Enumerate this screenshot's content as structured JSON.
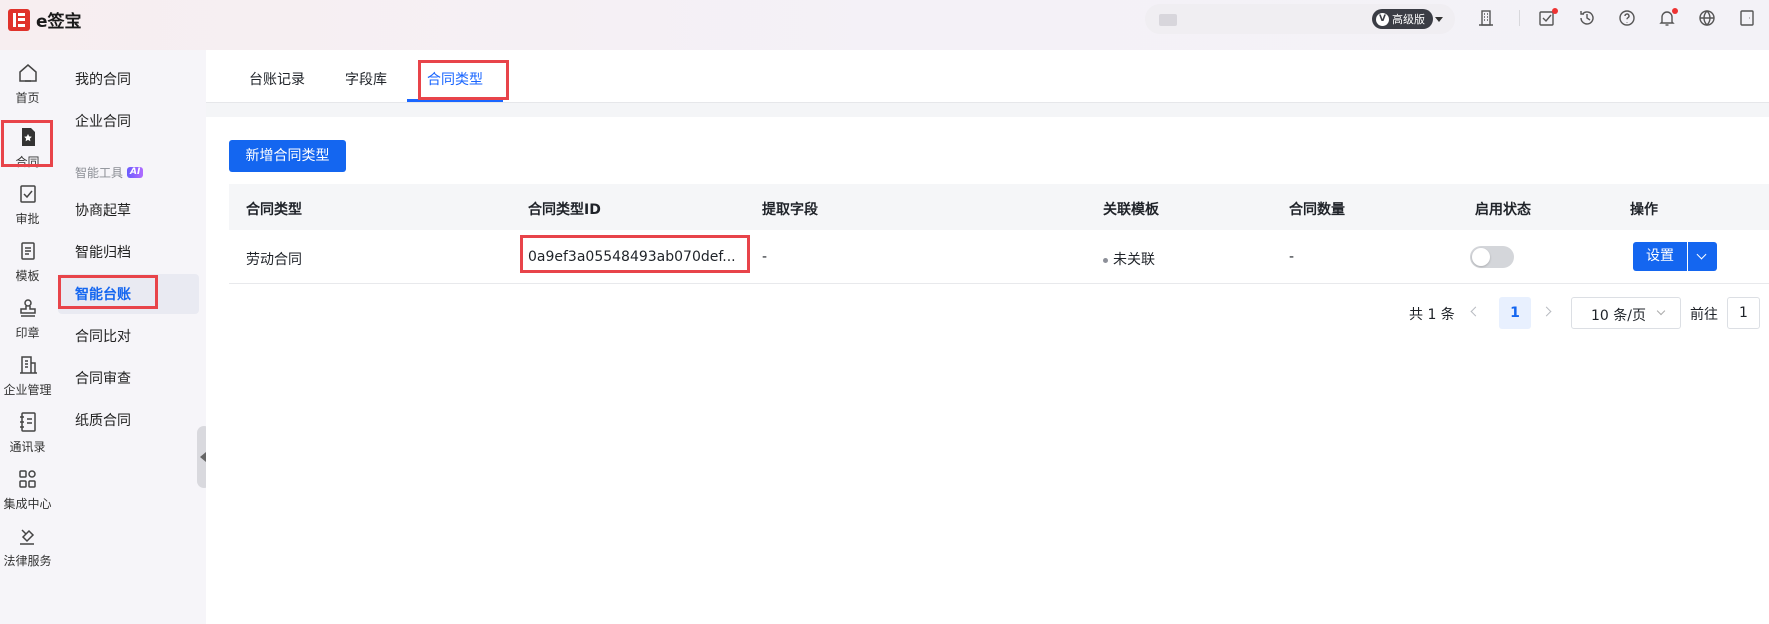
{
  "app": {
    "name": "e签宝"
  },
  "header": {
    "edition_badge": "高级版"
  },
  "rail": {
    "items": [
      {
        "label": "首页",
        "icon": "home-icon"
      },
      {
        "label": "合同",
        "icon": "contract-icon"
      },
      {
        "label": "审批",
        "icon": "approval-icon"
      },
      {
        "label": "模板",
        "icon": "template-icon"
      },
      {
        "label": "印章",
        "icon": "seal-icon"
      },
      {
        "label": "企业管理",
        "icon": "enterprise-icon"
      },
      {
        "label": "通讯录",
        "icon": "contacts-icon"
      },
      {
        "label": "集成中心",
        "icon": "integration-icon"
      },
      {
        "label": "法律服务",
        "icon": "legal-icon"
      }
    ]
  },
  "subnav": {
    "my_contracts": "我的合同",
    "enterprise_contracts": "企业合同",
    "section_label": "智能工具",
    "ai_badge": "AI",
    "negotiate": "协商起草",
    "archive": "智能归档",
    "ledger": "智能台账",
    "compare": "合同比对",
    "review": "合同审查",
    "paper": "纸质合同"
  },
  "tabs": [
    "台账记录",
    "字段库",
    "合同类型"
  ],
  "actions": {
    "add_type": "新增合同类型"
  },
  "table": {
    "headers": [
      "合同类型",
      "合同类型ID",
      "提取字段",
      "关联模板",
      "合同数量",
      "启用状态",
      "操作"
    ],
    "rows": [
      {
        "type": "劳动合同",
        "id": "0a9ef3a05548493ab070def...",
        "fields": "-",
        "template": "未关联",
        "count": "-",
        "enabled": false,
        "action": "设置"
      }
    ]
  },
  "pagination": {
    "total": "共 1 条",
    "current_page": "1",
    "page_size": "10 条/页",
    "goto_label": "前往",
    "goto_value": "1"
  }
}
